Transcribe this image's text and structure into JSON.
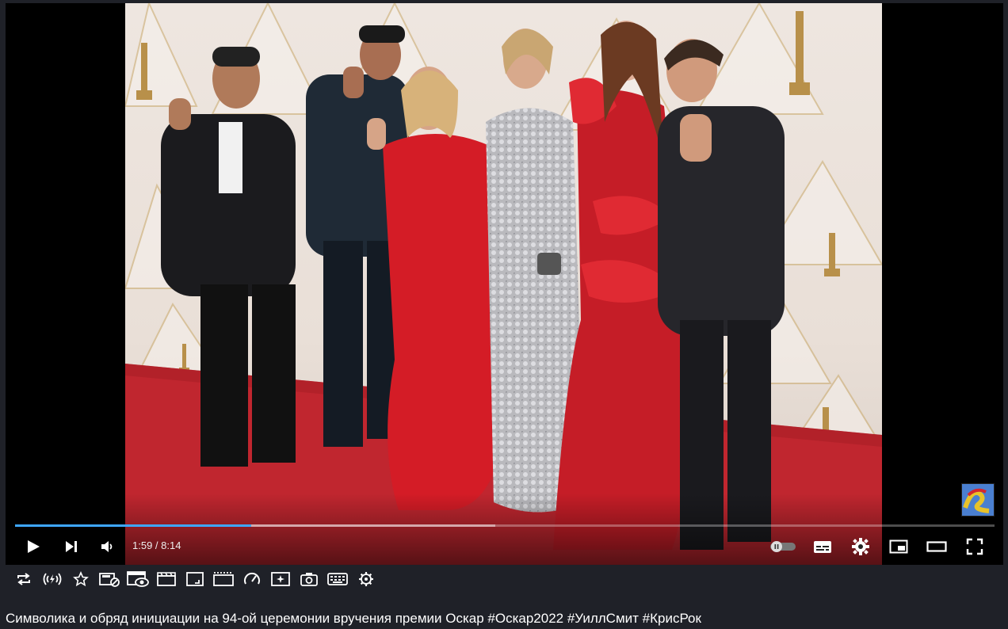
{
  "video": {
    "current_time": "1:59",
    "separator": " / ",
    "duration": "8:14",
    "played_fraction": 0.241,
    "buffered_fraction": 0.49
  },
  "controls": {
    "icons": [
      "play-icon",
      "next-icon",
      "volume-icon",
      "autoplay-toggle-icon",
      "subtitles-icon",
      "settings-icon",
      "miniplayer-icon",
      "theater-mode-icon",
      "fullscreen-icon"
    ]
  },
  "extension_toolbar": {
    "icons": [
      "loop-icon",
      "audio-mode-icon",
      "favorite-star-icon",
      "ads-blocker-icon",
      "popup-player-icon",
      "cinema-mode-icon",
      "aspect-ratio-icon",
      "frame-by-frame-icon",
      "playback-speed-icon",
      "filters-icon",
      "screenshot-icon",
      "keyboard-shortcuts-icon",
      "extension-settings-icon"
    ]
  },
  "video_title": "Символика и обряд инициации на 94-ой церемонии вручения премии Оскар #Оскар2022 #УиллСмит #КрисРок",
  "colors": {
    "progress_played": "#3ea6ff",
    "page_background": "#1f2128",
    "carpet": "#c0262f",
    "dress_red": "#d41c26"
  }
}
